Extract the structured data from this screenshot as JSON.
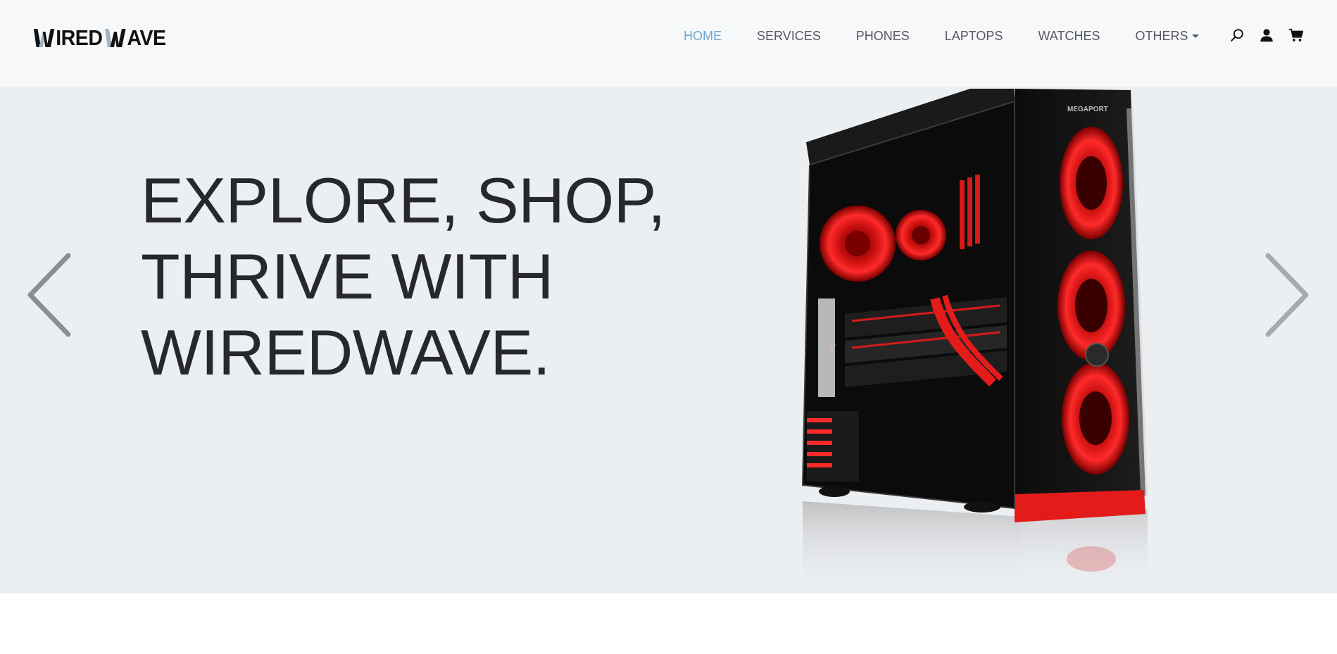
{
  "brand": {
    "logo_text": "IRED AVE",
    "name": "WIREDWAVE"
  },
  "nav": {
    "items": [
      {
        "label": "HOME",
        "active": true
      },
      {
        "label": "SERVICES",
        "active": false
      },
      {
        "label": "PHONES",
        "active": false
      },
      {
        "label": "LAPTOPS",
        "active": false
      },
      {
        "label": "WATCHES",
        "active": false
      },
      {
        "label": "OTHERS",
        "active": false,
        "dropdown": true
      }
    ]
  },
  "header_icons": [
    "search-icon",
    "user-icon",
    "cart-icon"
  ],
  "hero": {
    "headline_lines": [
      "EXPLORE, SHOP,",
      "THRIVE WITH",
      "WIREDWAVE."
    ],
    "case_brand": "MEGAPORT",
    "image_subject": "gaming-pc-icon"
  },
  "colors": {
    "header_bg": "#f7f8fa",
    "hero_bg": "#eceff2",
    "nav_active": "#6ea8cd",
    "nav_text": "#555a60",
    "headline": "#26282b",
    "accent_red": "#e31b1b"
  }
}
